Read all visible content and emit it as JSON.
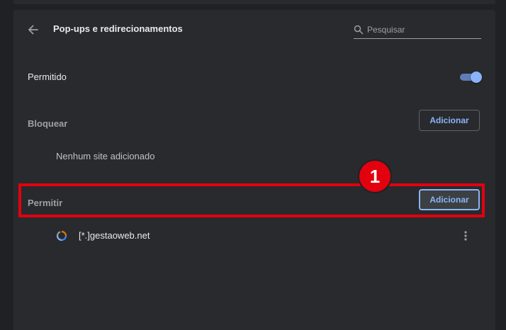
{
  "header": {
    "title": "Pop-ups e redirecionamentos",
    "back_icon": "arrow-left-icon",
    "search": {
      "placeholder": "Pesquisar",
      "value": ""
    }
  },
  "allowed_setting": {
    "label": "Permitido",
    "enabled": true
  },
  "block_section": {
    "label": "Bloquear",
    "add_label": "Adicionar",
    "empty_text": "Nenhum site adicionado"
  },
  "allow_section": {
    "label": "Permitir",
    "add_label": "Adicionar",
    "sites": [
      {
        "name": "[*.]gestaoweb.net",
        "favicon": "site-favicon-icon",
        "menu_icon": "more-vert-icon"
      }
    ]
  },
  "annotation": {
    "step_number": "1"
  },
  "colors": {
    "background": "#202124",
    "card": "#292a2d",
    "accent": "#8ab4f8",
    "highlight": "#e3000f"
  }
}
